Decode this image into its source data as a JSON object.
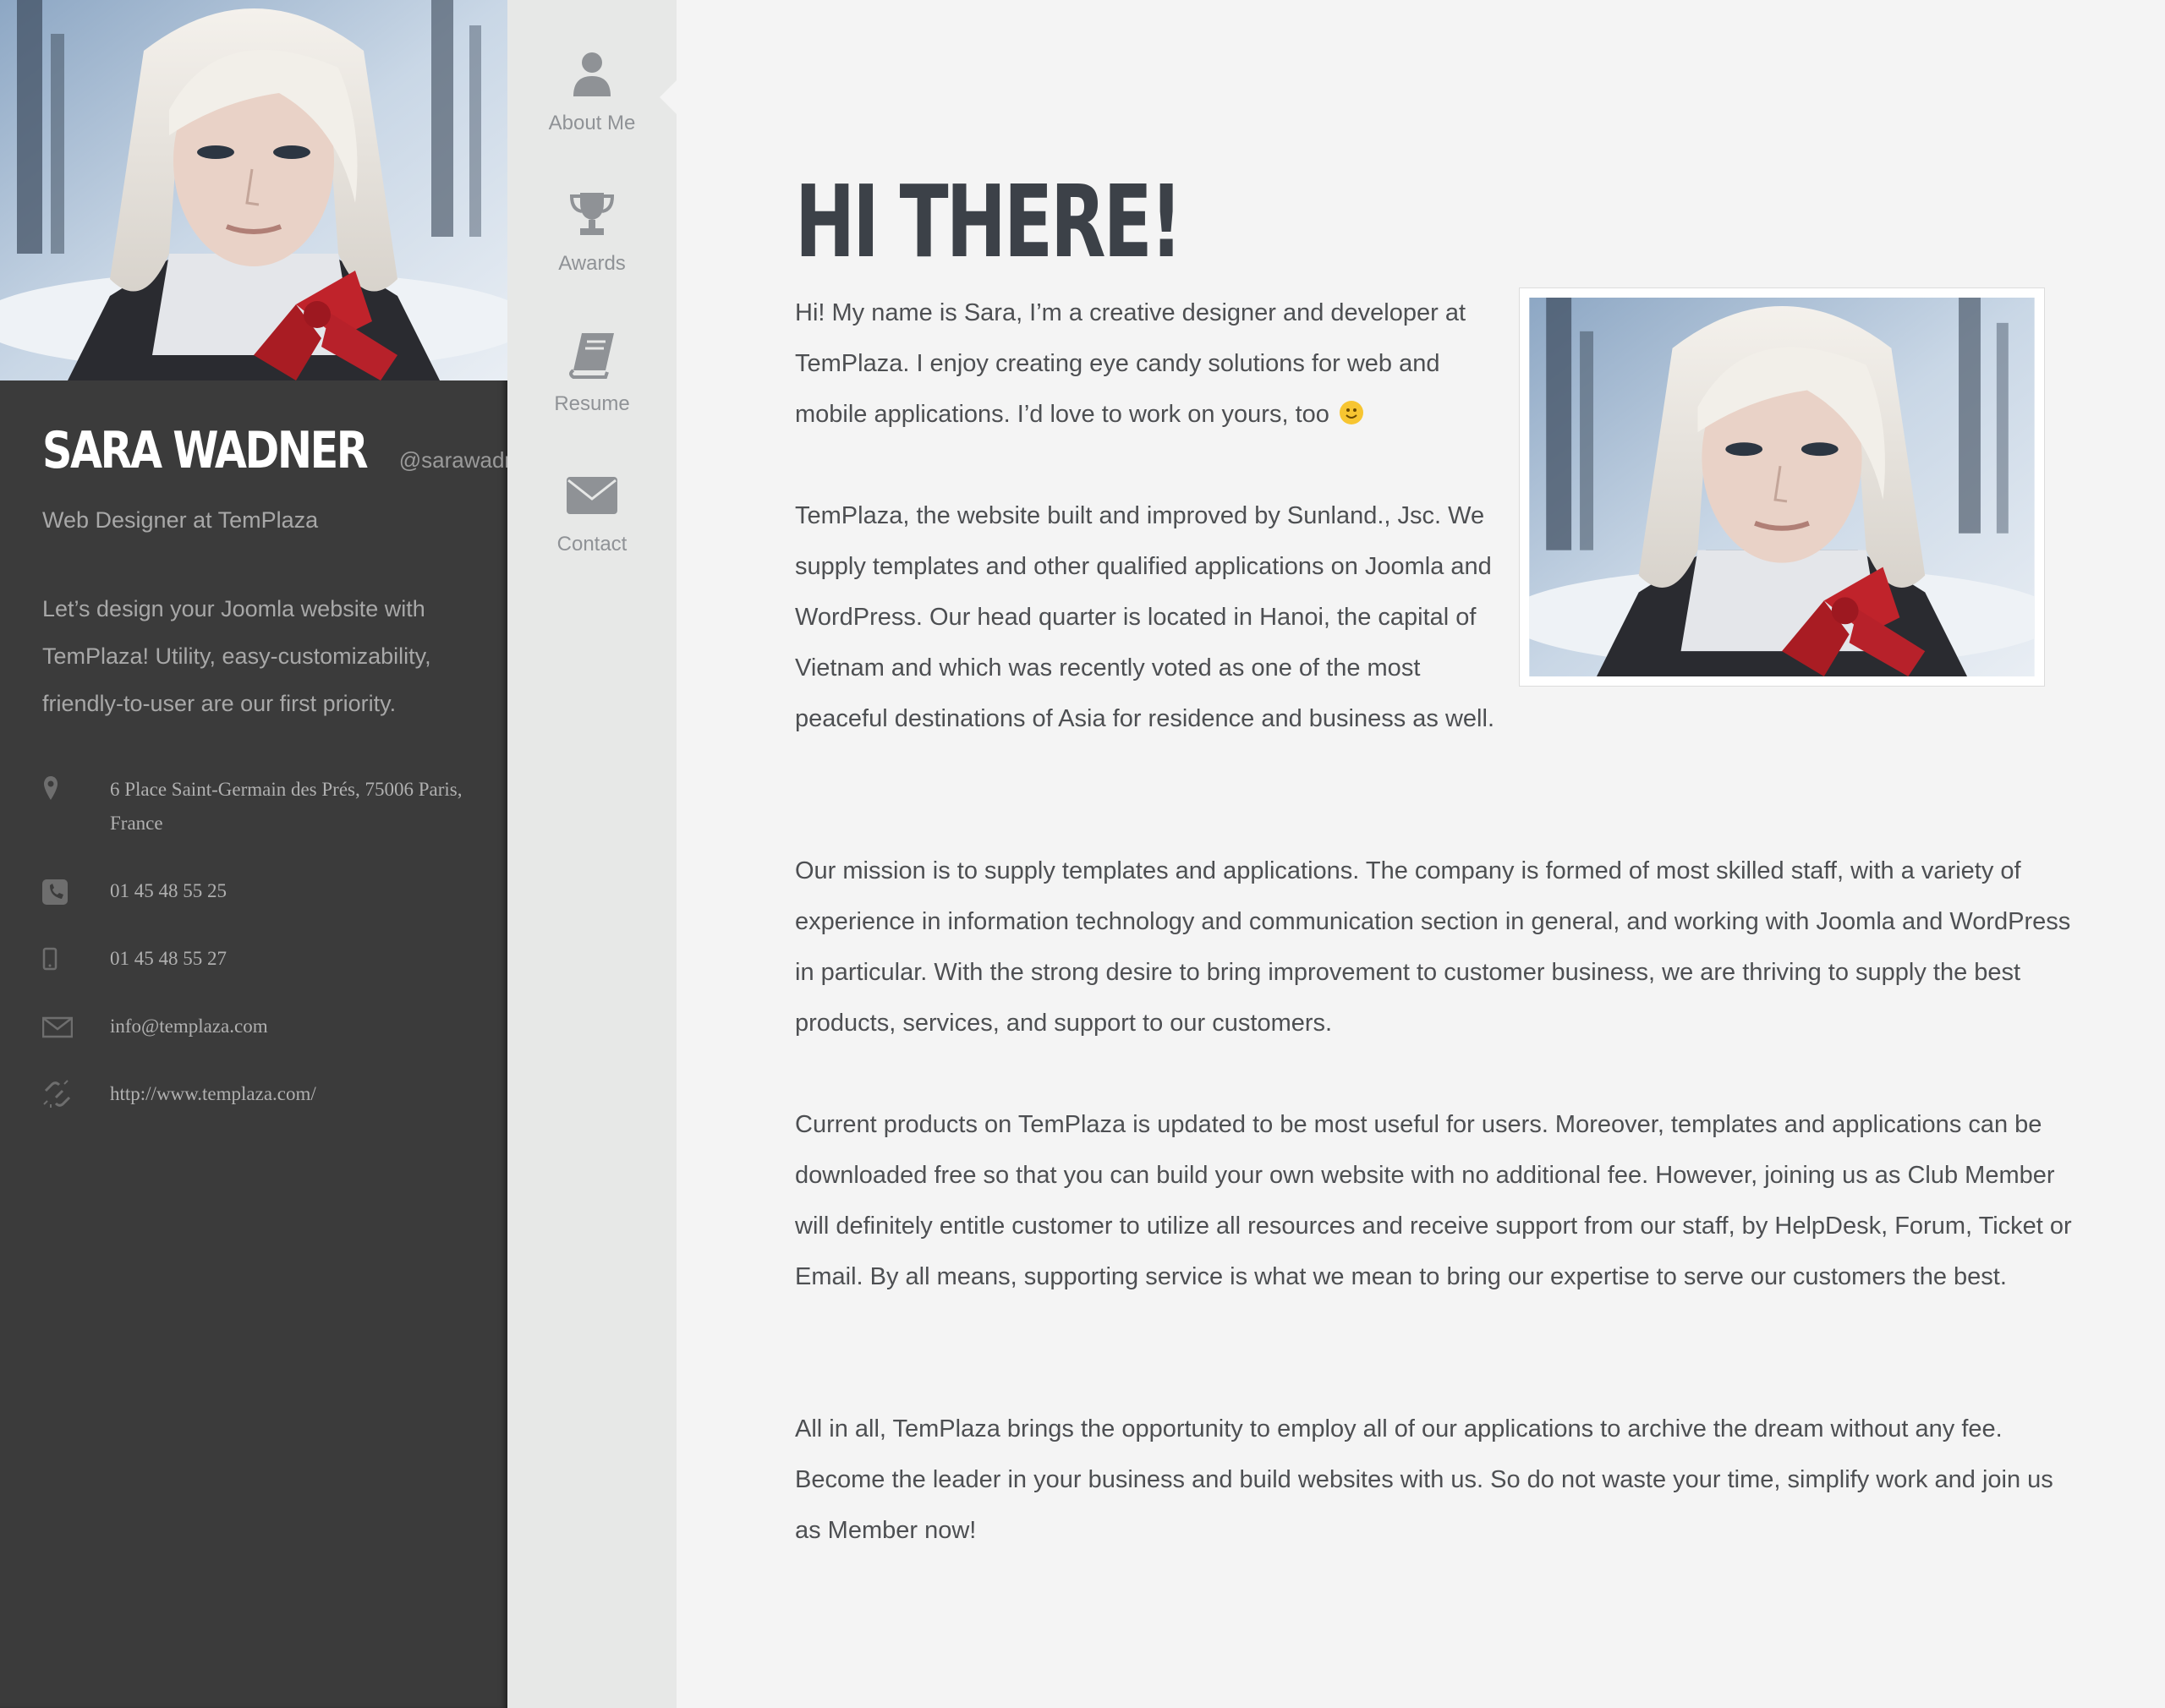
{
  "profile": {
    "name": "SARA WADNER",
    "handle": "@sarawadner",
    "job_title": "Web Designer at TemPlaza",
    "bio": "Let’s design your Joomla website with TemPlaza! Utility, easy-customizability, friendly-to-user are our first priority.",
    "contacts": [
      {
        "icon": "map-pin-icon",
        "text": "6 Place Saint-Germain des Prés, 75006 Paris, France"
      },
      {
        "icon": "phone-icon",
        "text": "01 45 48 55 25"
      },
      {
        "icon": "mobile-icon",
        "text": "01 45 48 55 27"
      },
      {
        "icon": "envelope-icon",
        "text": "info@templaza.com"
      },
      {
        "icon": "link-icon",
        "text": "http://www.templaza.com/"
      }
    ]
  },
  "nav": {
    "items": [
      {
        "label": "About Me",
        "icon": "user-icon",
        "active": true
      },
      {
        "label": "Awards",
        "icon": "trophy-icon",
        "active": false
      },
      {
        "label": "Resume",
        "icon": "book-icon",
        "active": false
      },
      {
        "label": "Contact",
        "icon": "envelope-icon",
        "active": false
      }
    ]
  },
  "main": {
    "title": "HI THERE!",
    "paragraphs": [
      "Hi! My name is Sara, I’m a creative designer and developer at TemPlaza. I enjoy creating eye candy solutions for web and mobile applications. I’d love to work on yours, too",
      "TemPlaza, the website built and improved by Sunland., Jsc. We supply templates and other qualified applications on Joomla and WordPress. Our head quarter is located in Hanoi, the capital of Vietnam and which was recently voted as one of the most peaceful destinations of Asia for residence and business as well.",
      "Our mission is to supply templates and applications. The company is formed of most skilled staff, with a variety of experience in information technology and communication section in general, and working with Joomla and WordPress in particular. With the strong desire to bring improvement to customer business, we are thriving to supply the best products, services, and support to our customers.",
      "Current products on TemPlaza is updated to be most useful for users. Moreover, templates and applications can be downloaded free so that you can build your own website with no additional fee. However, joining us as Club Member will definitely entitle customer to utilize all resources and receive support from our staff, by HelpDesk, Forum, Ticket or Email. By all means, supporting service is what we mean to bring our expertise to serve our customers the best.",
      "All in all, TemPlaza brings the opportunity to employ all of our applications to archive the dream without any fee. Become the leader in your business and build websites with us. So do not waste your time, simplify work and join us as Member now!"
    ]
  },
  "colors": {
    "sidebar_bg": "#3b3b3b",
    "nav_bg": "#e7e8e7",
    "content_bg": "#f4f4f4",
    "title_color": "#3c4148",
    "nav_icon_color": "#8f9296"
  }
}
